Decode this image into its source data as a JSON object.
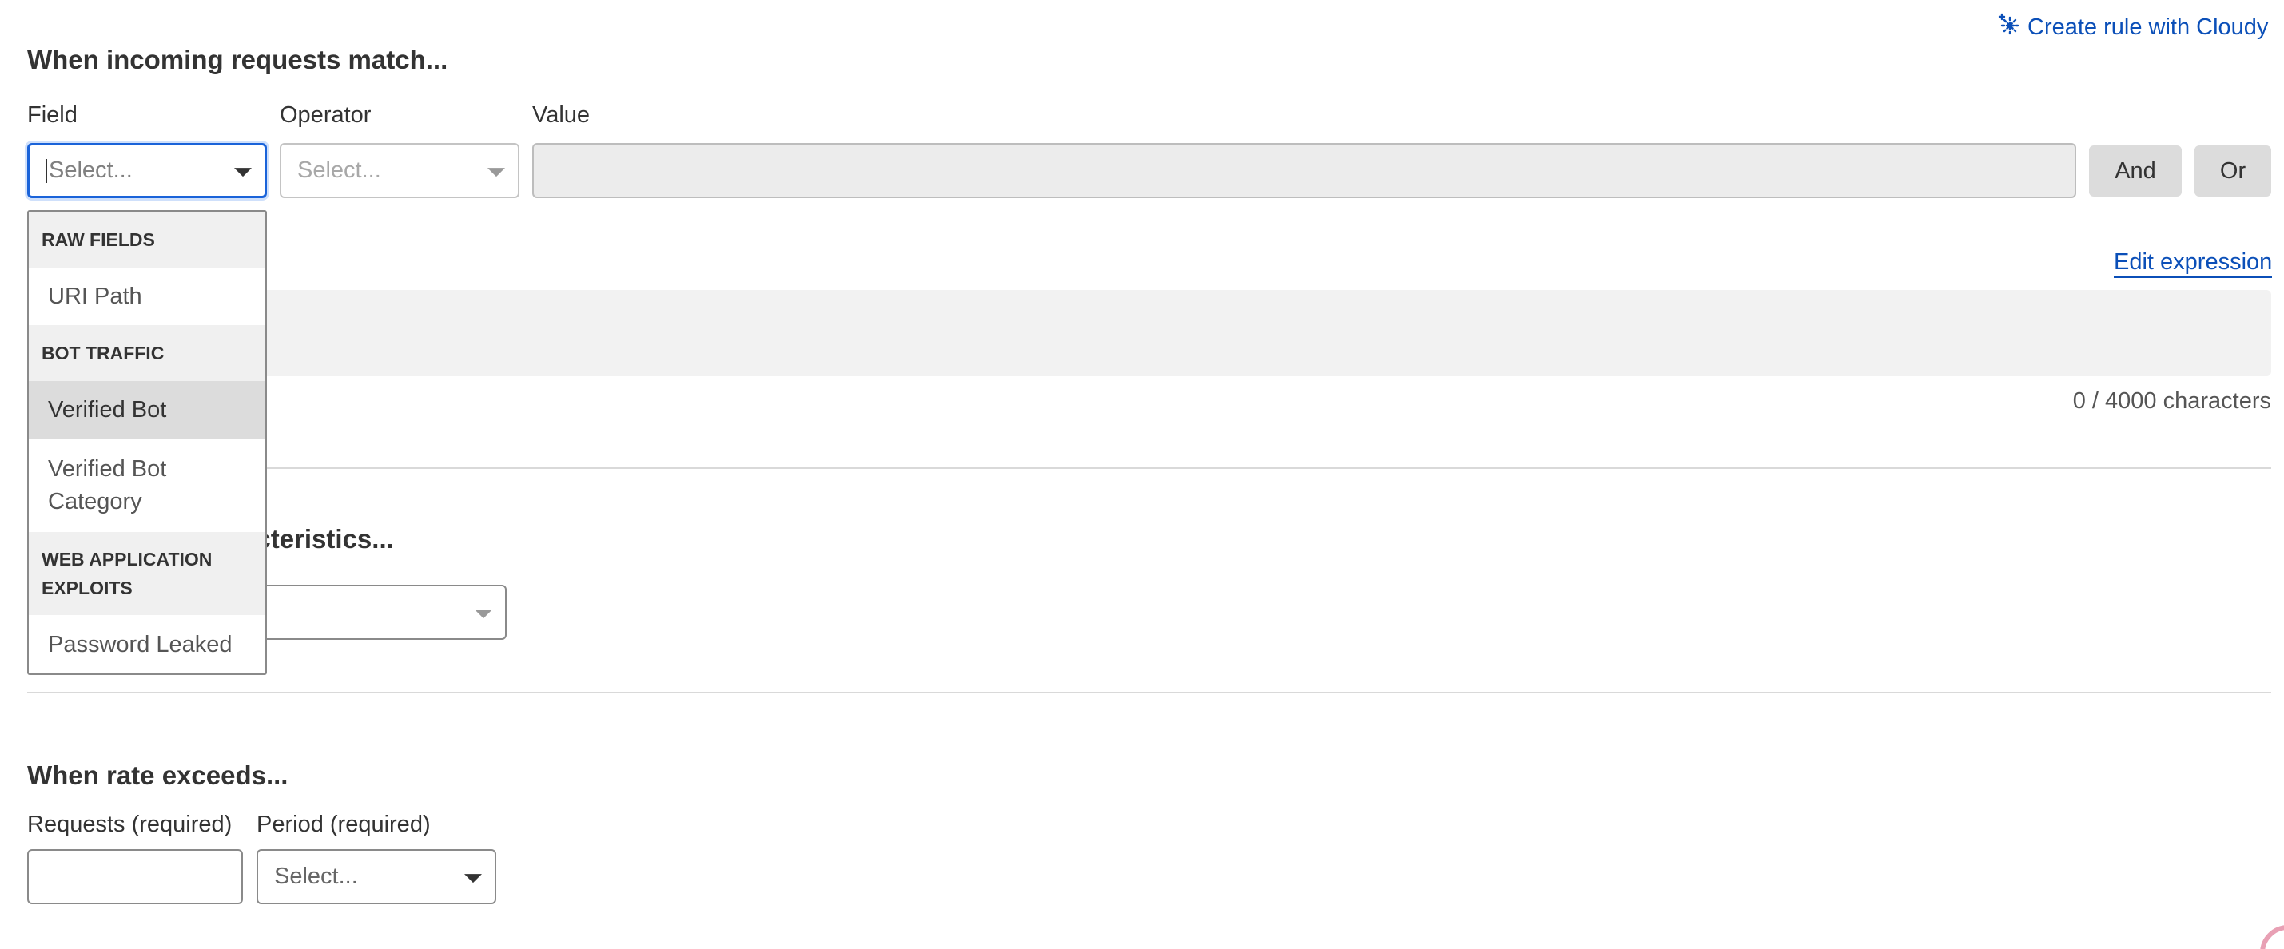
{
  "cloudy_link": {
    "icon": "sparkle-icon",
    "label": "Create rule with Cloudy"
  },
  "match_section": {
    "title": "When incoming requests match...",
    "field_label": "Field",
    "operator_label": "Operator",
    "value_label": "Value",
    "field_placeholder": "Select...",
    "operator_placeholder": "Select...",
    "value": "",
    "and_label": "And",
    "or_label": "Or"
  },
  "field_dropdown": {
    "groups": [
      {
        "label": "RAW FIELDS",
        "items": [
          "URI Path"
        ]
      },
      {
        "label": "BOT TRAFFIC",
        "items": [
          "Verified Bot",
          "Verified Bot Category"
        ]
      },
      {
        "label": "WEB APPLICATION EXPLOITS",
        "items": [
          "Password Leaked"
        ]
      }
    ],
    "highlighted": "Verified Bot"
  },
  "expression": {
    "edit_label": "Edit expression",
    "value": "",
    "char_count": "0 / 4000 characters"
  },
  "characteristics_section": {
    "title_visible": "acteristics..."
  },
  "rate_section": {
    "title": "When rate exceeds...",
    "requests_label": "Requests (required)",
    "requests_value": "",
    "period_label": "Period (required)",
    "period_placeholder": "Select..."
  },
  "colors": {
    "link": "#0b4fb8",
    "focus": "#1a63d9"
  }
}
